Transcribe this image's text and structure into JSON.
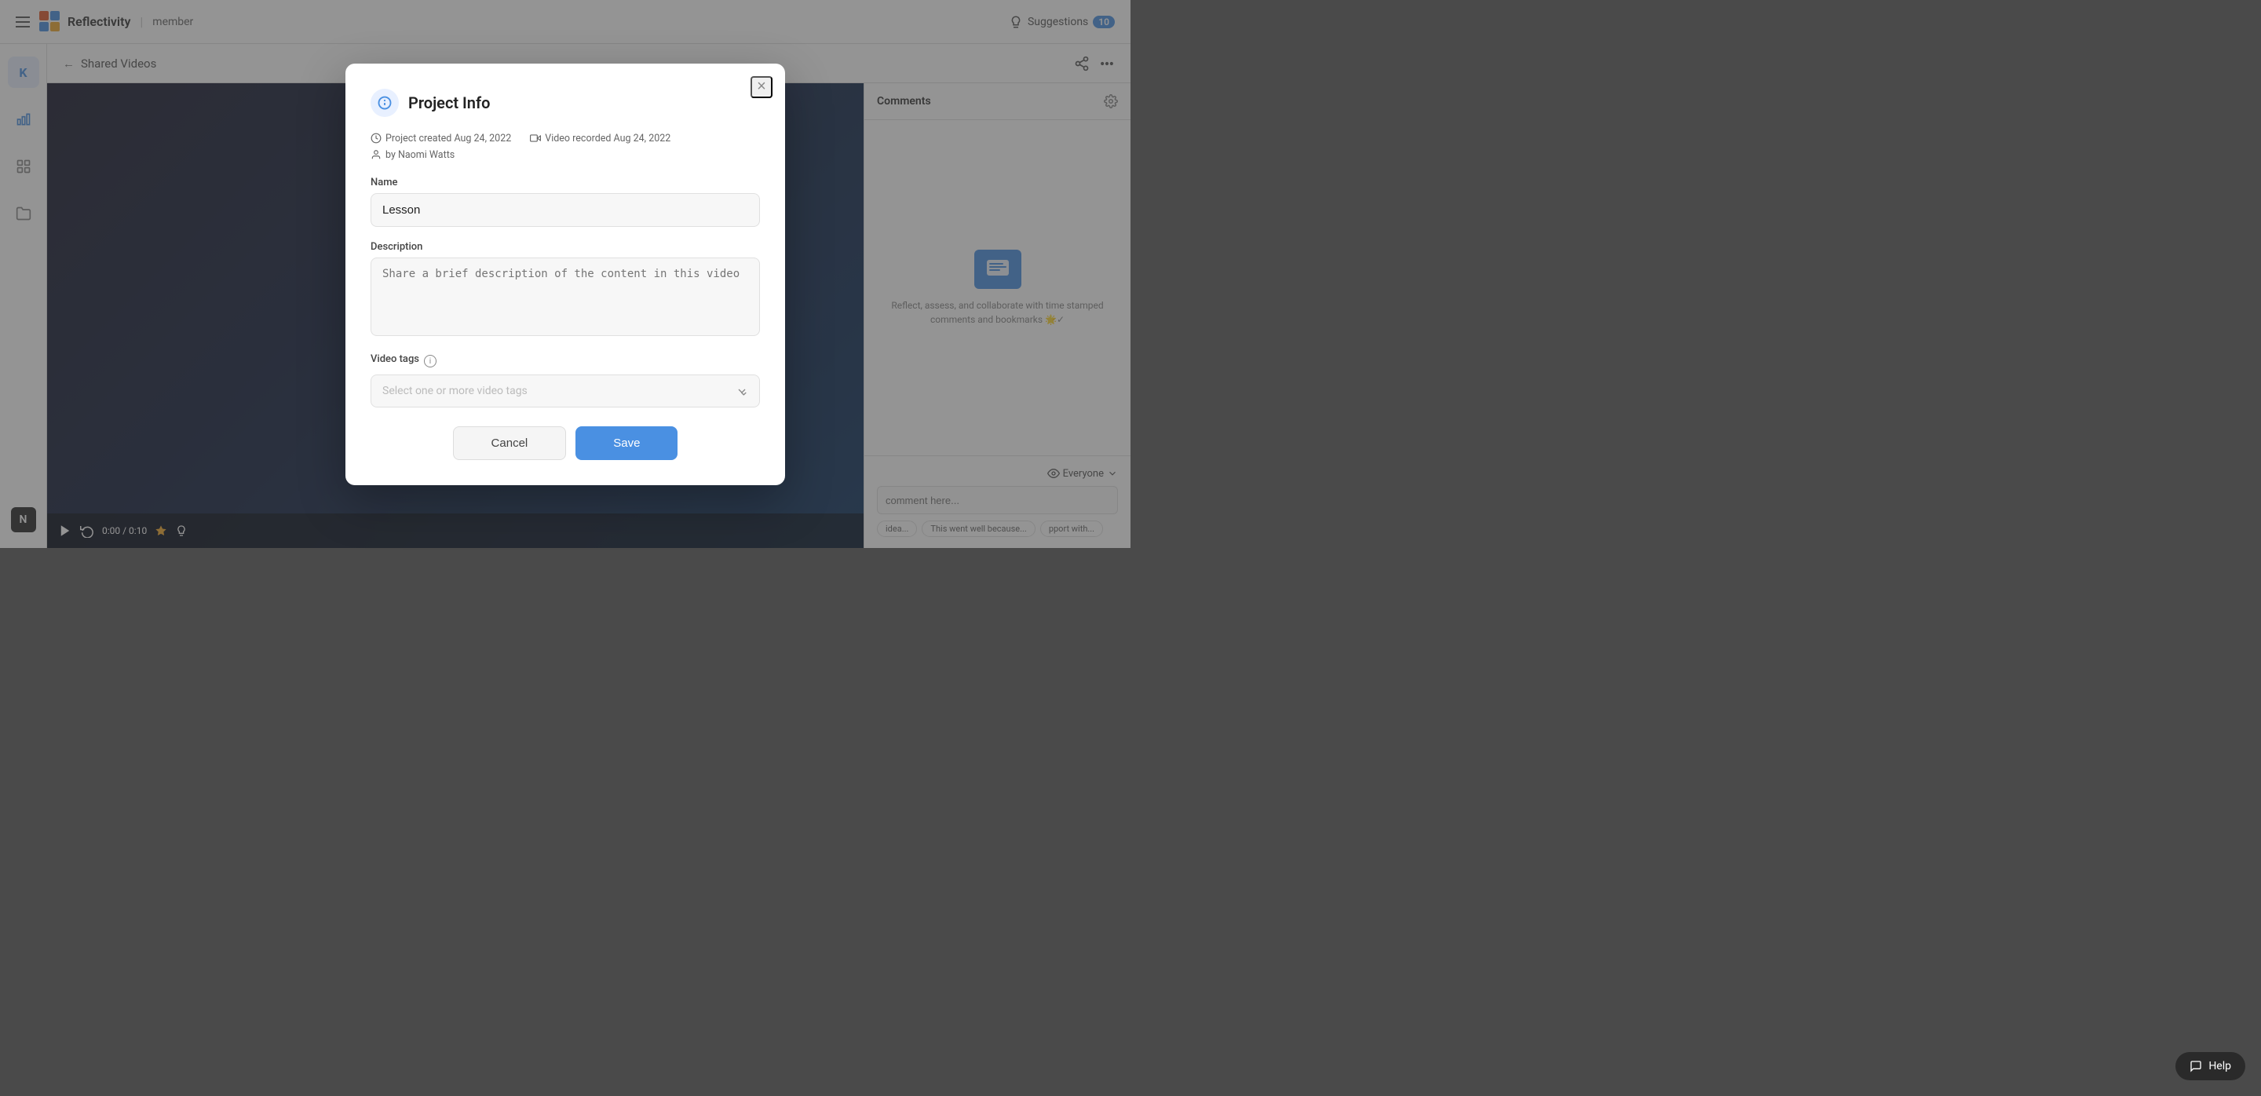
{
  "app": {
    "logo_text": "Reflectivity",
    "role_text": "member",
    "suggestions_label": "Suggestions",
    "suggestions_count": "10"
  },
  "sidebar": {
    "items": [
      {
        "id": "k-initial",
        "label": "K",
        "icon": "user-initial"
      },
      {
        "id": "dashboard",
        "icon": "bar-chart-icon"
      },
      {
        "id": "layouts",
        "icon": "grid-icon"
      },
      {
        "id": "folder",
        "icon": "folder-icon"
      }
    ]
  },
  "breadcrumb": {
    "back_label": "←",
    "title": "Shared Videos"
  },
  "video": {
    "time": "0:00 / 0:10"
  },
  "comments": {
    "title": "Comments",
    "desc": "Reflect, assess, and collaborate with time stamped comments and bookmarks 🌟✓",
    "visibility": "Everyone",
    "placeholder": "comment here...",
    "quick_replies": [
      "idea...",
      "This went well because...",
      "pport with..."
    ]
  },
  "modal": {
    "title": "Project Info",
    "close_label": "×",
    "meta": {
      "created_label": "Project created Aug 24, 2022",
      "recorded_label": "Video recorded Aug 24, 2022",
      "author_label": "by Naomi Watts"
    },
    "name_label": "Name",
    "name_value": "Lesson",
    "description_label": "Description",
    "description_placeholder": "Share a brief description of the content in this video",
    "video_tags_label": "Video tags",
    "video_tags_placeholder": "Select one or more video tags",
    "info_icon": "ℹ",
    "cancel_label": "Cancel",
    "save_label": "Save"
  },
  "help": {
    "label": "Help"
  }
}
